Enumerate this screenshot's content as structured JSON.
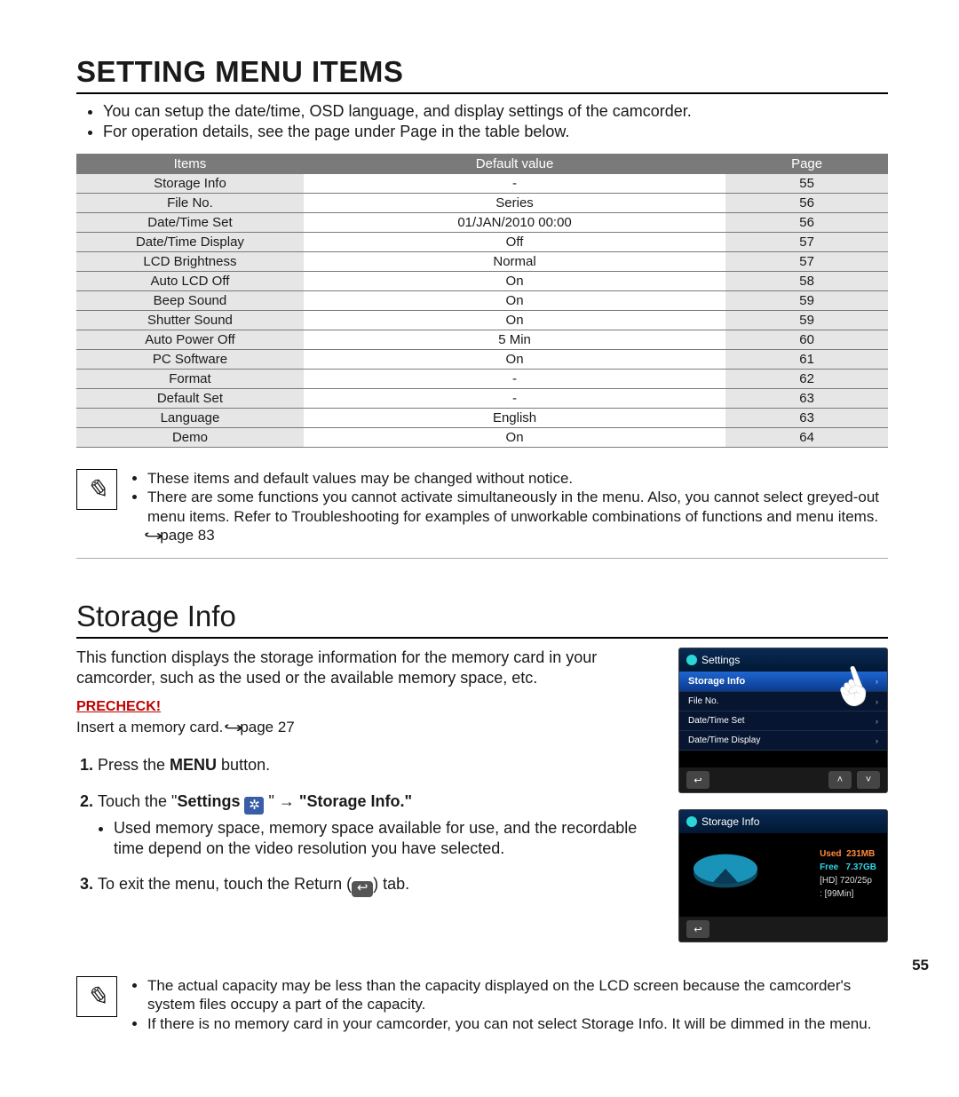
{
  "heading1": "SETTING MENU ITEMS",
  "intro": [
    "You can setup the date/time, OSD language, and display settings of the camcorder.",
    "For operation details, see the page under Page in the table below."
  ],
  "table": {
    "headers": [
      "Items",
      "Default value",
      "Page"
    ],
    "rows": [
      [
        "Storage Info",
        "-",
        "55"
      ],
      [
        "File No.",
        "Series",
        "56"
      ],
      [
        "Date/Time Set",
        "01/JAN/2010 00:00",
        "56"
      ],
      [
        "Date/Time Display",
        "Off",
        "57"
      ],
      [
        "LCD Brightness",
        "Normal",
        "57"
      ],
      [
        "Auto LCD Off",
        "On",
        "58"
      ],
      [
        "Beep Sound",
        "On",
        "59"
      ],
      [
        "Shutter Sound",
        "On",
        "59"
      ],
      [
        "Auto Power Off",
        "5 Min",
        "60"
      ],
      [
        "PC Software",
        "On",
        "61"
      ],
      [
        "Format",
        "-",
        "62"
      ],
      [
        "Default Set",
        "-",
        "63"
      ],
      [
        "Language",
        "English",
        "63"
      ],
      [
        "Demo",
        "On",
        "64"
      ]
    ]
  },
  "note1": [
    "These items and default values may be changed without notice.",
    "There are some functions you cannot activate simultaneously in the menu. Also, you cannot select greyed-out menu items. Refer to Troubleshooting for examples of unworkable combinations of functions and menu items. ",
    "page 83"
  ],
  "heading2": "Storage Info",
  "desc": "This function displays the storage information for the memory card in your camcorder, such as the used or the available memory space, etc.",
  "precheck_label": "PRECHECK!",
  "precheck_text": "Insert a memory card. ",
  "precheck_page": "page 27",
  "steps": {
    "s1_a": "Press the ",
    "s1_b": "MENU",
    "s1_c": " button.",
    "s2_a": "Touch the \"",
    "s2_b": "Settings",
    "s2_arrow": " → ",
    "s2_c": "\"Storage Info.\"",
    "s2_sub": "Used memory space, memory space available for use, and the recordable time depend on the video resolution you have selected.",
    "s3_a": "To exit the menu, touch the Return (",
    "s3_b": ") tab."
  },
  "shot1": {
    "title": "Settings",
    "rows": [
      "Storage Info",
      "File No.",
      "Date/Time Set",
      "Date/Time Display"
    ]
  },
  "shot2": {
    "title": "Storage Info",
    "used_label": "Used",
    "used_val": "231MB",
    "free_label": "Free",
    "free_val": "7.37GB",
    "res": "[HD] 720/25p",
    "rec": ": [99Min]"
  },
  "note2": [
    "The actual capacity may be less than the capacity displayed on the LCD screen because the camcorder's system files occupy a part of the capacity.",
    "If there is no memory card in your camcorder, you can not select Storage Info. It will be dimmed in the menu."
  ],
  "page_number": "55"
}
